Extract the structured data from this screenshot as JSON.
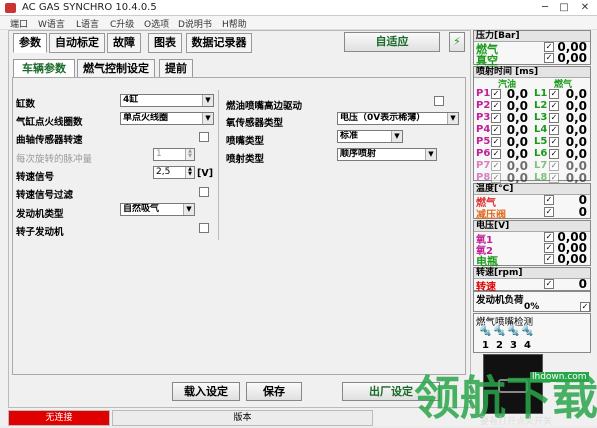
{
  "app": {
    "title": "AC GAS SYNCHRO  10.4.0.5",
    "min": "─",
    "max": "□",
    "close": "✕"
  },
  "menu": [
    "端口",
    "W语言",
    "L语言",
    "C升级",
    "O选项",
    "D说明书",
    "H帮助"
  ],
  "tabs": [
    "参数",
    "自动标定",
    "故障",
    "图表",
    "数据记录器"
  ],
  "adapt_btn": "自适应",
  "subtabs": [
    "车辆参数",
    "燃气控制设定",
    "提前"
  ],
  "left_rows": [
    {
      "label": "缸数",
      "value": "4缸"
    },
    {
      "label": "气缸点火线圈数",
      "value": "单点火线圈"
    },
    {
      "label": "曲轴传感器转速"
    },
    {
      "label": "每次旋转的脉冲量",
      "value": "1"
    },
    {
      "label": "转速信号",
      "value": "2,5",
      "unit": "[V]"
    },
    {
      "label": "转速信号过滤"
    },
    {
      "label": "发动机类型",
      "value": "自然吸气"
    },
    {
      "label": "转子发动机"
    }
  ],
  "right_rows": [
    {
      "label": "燃油喷嘴高边驱动"
    },
    {
      "label": "氧传感器类型",
      "value": "电压（0V表示稀薄）"
    },
    {
      "label": "喷嘴类型",
      "value": "标准"
    },
    {
      "label": "喷射类型",
      "value": "顺序喷射"
    }
  ],
  "buttons": {
    "load": "载入设定",
    "save": "保存",
    "factory": "出厂设定"
  },
  "pressure": {
    "head": "压力[Bar]",
    "gas_label": "燃气",
    "gas_val": "0,00",
    "vac_label": "真空",
    "vac_val": "0,00"
  },
  "inject": {
    "head": "喷射时间 [ms]",
    "col_petrol": "汽油",
    "col_gas": "燃气",
    "rows": [
      [
        "P1",
        "0,0",
        "L1",
        "0,0"
      ],
      [
        "P2",
        "0,0",
        "L2",
        "0,0"
      ],
      [
        "P3",
        "0,0",
        "L3",
        "0,0"
      ],
      [
        "P4",
        "0,0",
        "L4",
        "0,0"
      ],
      [
        "P5",
        "0,0",
        "L5",
        "0,0"
      ],
      [
        "P6",
        "0,0",
        "L6",
        "0,0"
      ],
      [
        "P7",
        "0,0",
        "L7",
        "0,0"
      ],
      [
        "P8",
        "0,0",
        "L8",
        "0,0"
      ]
    ]
  },
  "temp": {
    "head": "温度[°C]",
    "gas_label": "燃气",
    "gas_val": "0",
    "red_label": "减压阀",
    "red_val": "0"
  },
  "voltage": {
    "head": "电压[V]",
    "l1": "氧1",
    "v1": "0,00",
    "l2": "氧2",
    "v2": "0,00",
    "l3": "电瓶",
    "v3": "0,00"
  },
  "rpm": {
    "head": "转速[rpm]",
    "label": "转速",
    "val": "0"
  },
  "load": {
    "head": "发动机负荷",
    "val": "0%"
  },
  "injector_check": {
    "head": "燃气喷嘴检测",
    "nums": [
      "1",
      "2",
      "3",
      "4"
    ]
  },
  "status": {
    "left": "无连接",
    "mid": "版本"
  },
  "watermark": {
    "text": "领航下载",
    "site": "lhdown.com",
    "sub": "要有打开点火开关"
  },
  "colors": {
    "green": "#1a9a1a",
    "magenta": "#c0209a",
    "red": "#e00000"
  }
}
